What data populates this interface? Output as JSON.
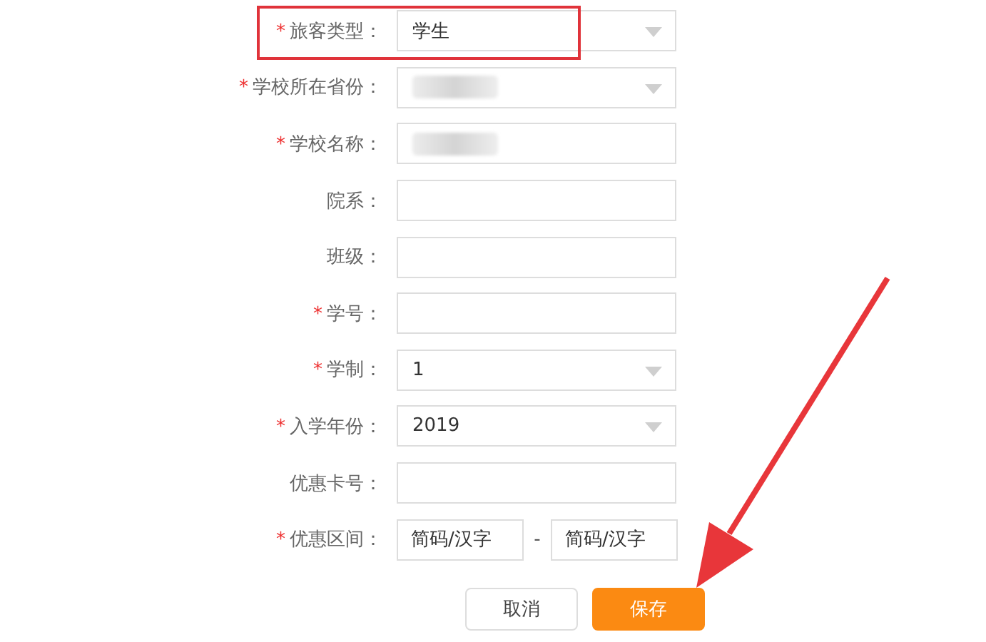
{
  "fields": [
    {
      "label": "旅客类型：",
      "required": true,
      "kind": "select",
      "value": "学生",
      "blurred": false,
      "highlighted": true
    },
    {
      "label": "学校所在省份：",
      "required": true,
      "kind": "select",
      "blurred": true,
      "highlighted": false
    },
    {
      "label": "学校名称：",
      "required": true,
      "kind": "input",
      "blurred": true,
      "highlighted": false
    },
    {
      "label": "院系：",
      "required": false,
      "kind": "input",
      "blurred": false,
      "highlighted": false
    },
    {
      "label": "班级：",
      "required": false,
      "kind": "input",
      "blurred": false,
      "highlighted": false
    },
    {
      "label": "学号：",
      "required": true,
      "kind": "input",
      "blurred": false,
      "highlighted": false
    },
    {
      "label": "学制：",
      "required": true,
      "kind": "select",
      "value": "1",
      "blurred": false,
      "highlighted": false
    },
    {
      "label": "入学年份：",
      "required": true,
      "kind": "select",
      "value": "2019",
      "blurred": false,
      "highlighted": false
    },
    {
      "label": "优惠卡号：",
      "required": false,
      "kind": "input",
      "blurred": false,
      "highlighted": false
    },
    {
      "label": "优惠区间：",
      "required": true,
      "kind": "range",
      "from_placeholder": "简码/汉字",
      "separator": "-",
      "to_placeholder": "简码/汉字",
      "blurred": false,
      "highlighted": false
    }
  ],
  "required_mark": "*",
  "buttons": [
    {
      "label": "取消",
      "kind": "secondary"
    },
    {
      "label": "保存",
      "kind": "primary"
    }
  ],
  "annotation": {
    "arrow": true
  }
}
